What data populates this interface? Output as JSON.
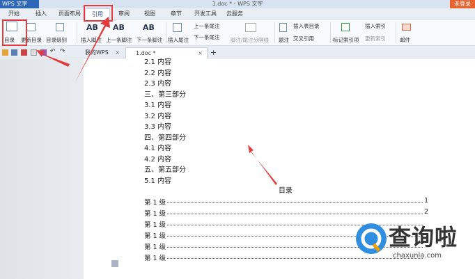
{
  "titlebar": {
    "app": "WPS 文字",
    "title": "1.doc * - WPS 文字",
    "login": "未登录"
  },
  "menu": [
    "开始",
    "插入",
    "页面布局",
    "引用",
    "审阅",
    "视图",
    "章节",
    "开发工具",
    "云服务"
  ],
  "ribbon": {
    "toc": "目录",
    "update_toc": "更新目录",
    "toc_level": "目录级别",
    "insert_footnote": "插入脚注",
    "prev_footnote": "上一条脚注",
    "next_footnote": "下一条脚注",
    "insert_endnote": "插入尾注",
    "prev_endnote": "上一条尾注",
    "next_endnote": "下一条尾注",
    "note_separator": "脚注/尾注分隔线",
    "caption": "题注",
    "insert_figure_index": "插入表目录",
    "cross_reference": "交叉引用",
    "mark_index": "标记索引项",
    "insert_index": "插入索引",
    "update_index": "更新索引",
    "mail": "邮件"
  },
  "tabs": {
    "mywps": "我的WPS",
    "doc": "1.doc *",
    "add": "+"
  },
  "document": {
    "lines": [
      "2.1 内容",
      "2.2 内容",
      "2.3 内容",
      "三、第三部分",
      "3.1 内容",
      "3.2 内容",
      "3.3 内容",
      "四、第四部分",
      "4.1 内容",
      "4.2 内容",
      "五、第五部分",
      "5.1 内容"
    ],
    "toc_title": "目录",
    "toc_rows": [
      {
        "label": "第 1 级",
        "page": "1"
      },
      {
        "label": "第 1 级",
        "page": "2"
      },
      {
        "label": "第 1 级",
        "page": ""
      },
      {
        "label": "第 1 级",
        "page": ""
      },
      {
        "label": "第 1 级",
        "page": ""
      },
      {
        "label": "第 1 级",
        "page": ""
      }
    ]
  },
  "watermark": {
    "text": "查询啦",
    "url": "chaxunla.com"
  },
  "colors": {
    "accent": "#2f67b8",
    "annotation": "#e23c3c",
    "login": "#e8622f"
  }
}
